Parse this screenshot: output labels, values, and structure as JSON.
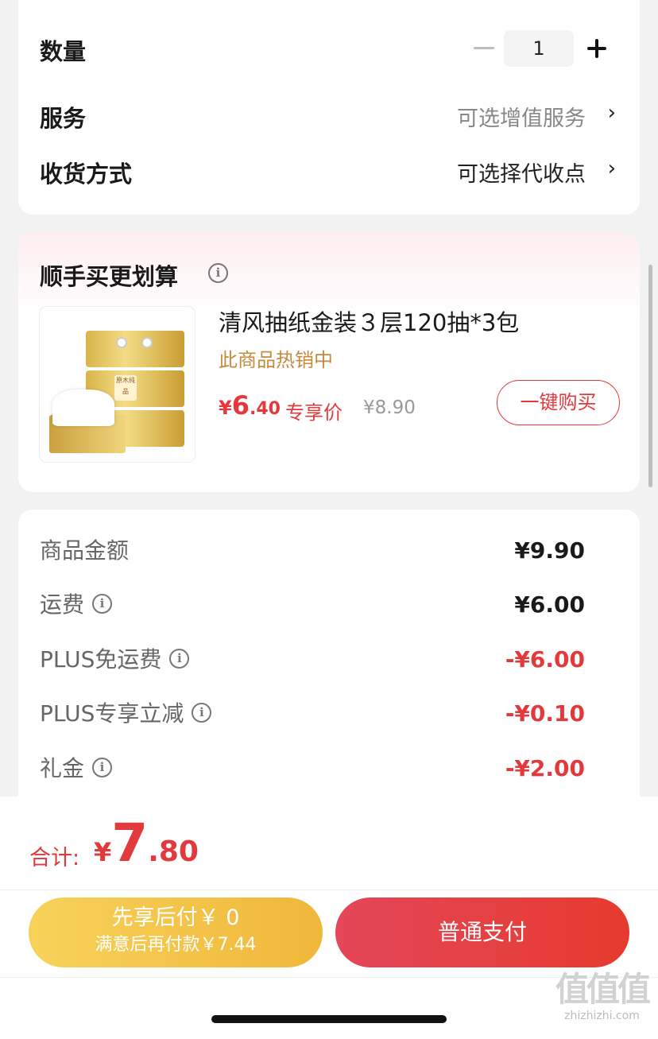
{
  "options": {
    "quantity_label": "数量",
    "quantity_value": "1",
    "service_label": "服务",
    "service_value": "可选增值服务",
    "delivery_label": "收货方式",
    "delivery_value": "可选择代收点",
    "chevron": "›"
  },
  "upsell": {
    "title": "顺手买更划算",
    "info": "i",
    "product_name": "清风抽纸金装３层120抽*3包",
    "hot_tag": "此商品热销中",
    "price_symbol": "¥",
    "price_int": "6",
    "price_dec": ".40",
    "price_tag": "专享价",
    "original_price": "¥8.90",
    "buy_button": "一键购买",
    "package_label": "原木纯品"
  },
  "summary": {
    "rows": [
      {
        "label": "商品金额",
        "value": "¥9.90"
      },
      {
        "label": "运费",
        "value": "¥6.00"
      },
      {
        "label": "PLUS免运费",
        "value": "-¥6.00"
      },
      {
        "label": "PLUS专享立减",
        "value": "-¥0.10"
      },
      {
        "label": "礼金",
        "value": "-¥2.00"
      }
    ],
    "info": "i"
  },
  "footer": {
    "total_label": "合计:",
    "total_symbol": "¥",
    "total_int": "7",
    "total_dec": ".80",
    "bnpl_line1": "先享后付￥ 0",
    "bnpl_line2": "满意后再付款￥7.44",
    "pay_button": "普通支付",
    "watermark_logo": "值值值",
    "watermark_site": "zhizhizhi.com"
  },
  "colors": {
    "accent_red": "#e4393c",
    "hot_gold": "#c58a3c",
    "bnpl_yellow": "#f0b73a",
    "pay_red": "#e63a2d"
  }
}
